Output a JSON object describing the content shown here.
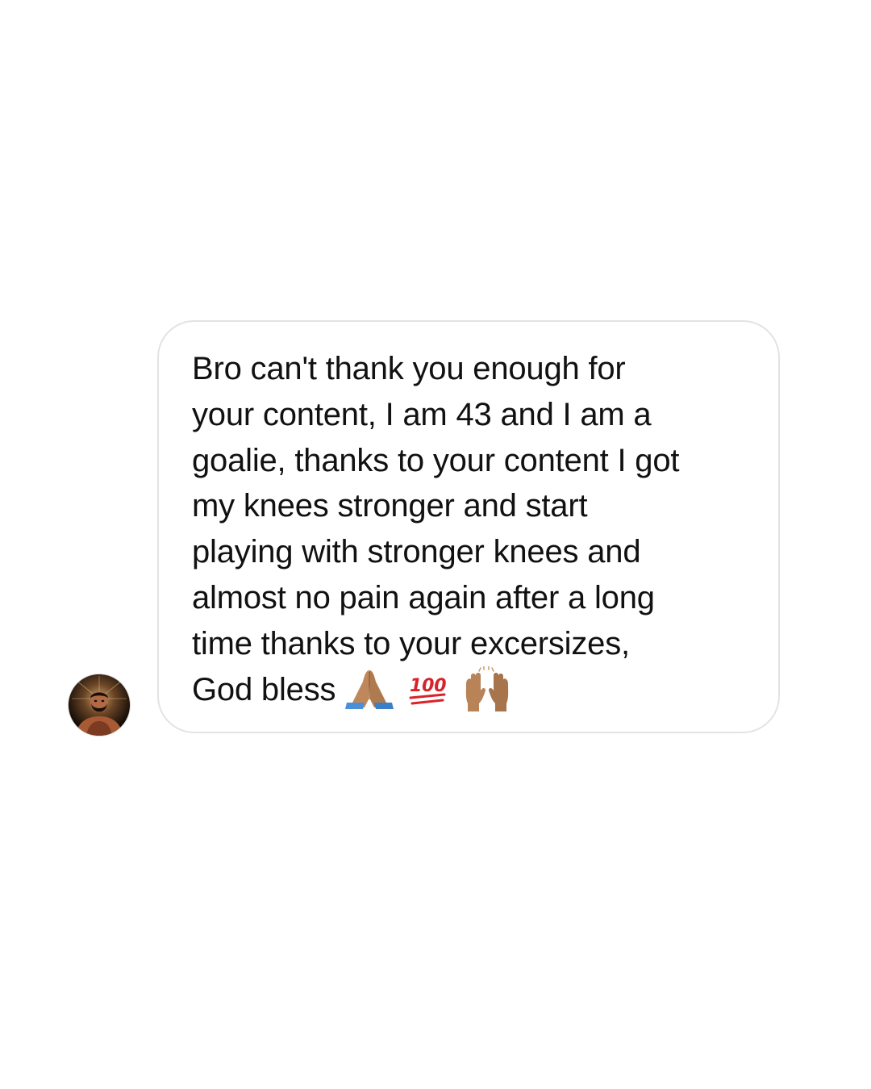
{
  "message": {
    "lines": [
      "Bro can't thank you enough for",
      "your content, I am 43 and I am a",
      "goalie, thanks to your content I got",
      "my knees stronger and start",
      "playing with stronger knees and",
      "almost no pain again after a long",
      "time thanks to your excersizes,",
      "God bless"
    ],
    "emojis": [
      "folded-hands-icon",
      "hundred-points-icon",
      "raising-hands-icon"
    ]
  },
  "sender": {
    "avatar_icon": "avatar"
  },
  "colors": {
    "bubble_border": "#e3e3e3",
    "text": "#111111",
    "background": "#ffffff"
  }
}
